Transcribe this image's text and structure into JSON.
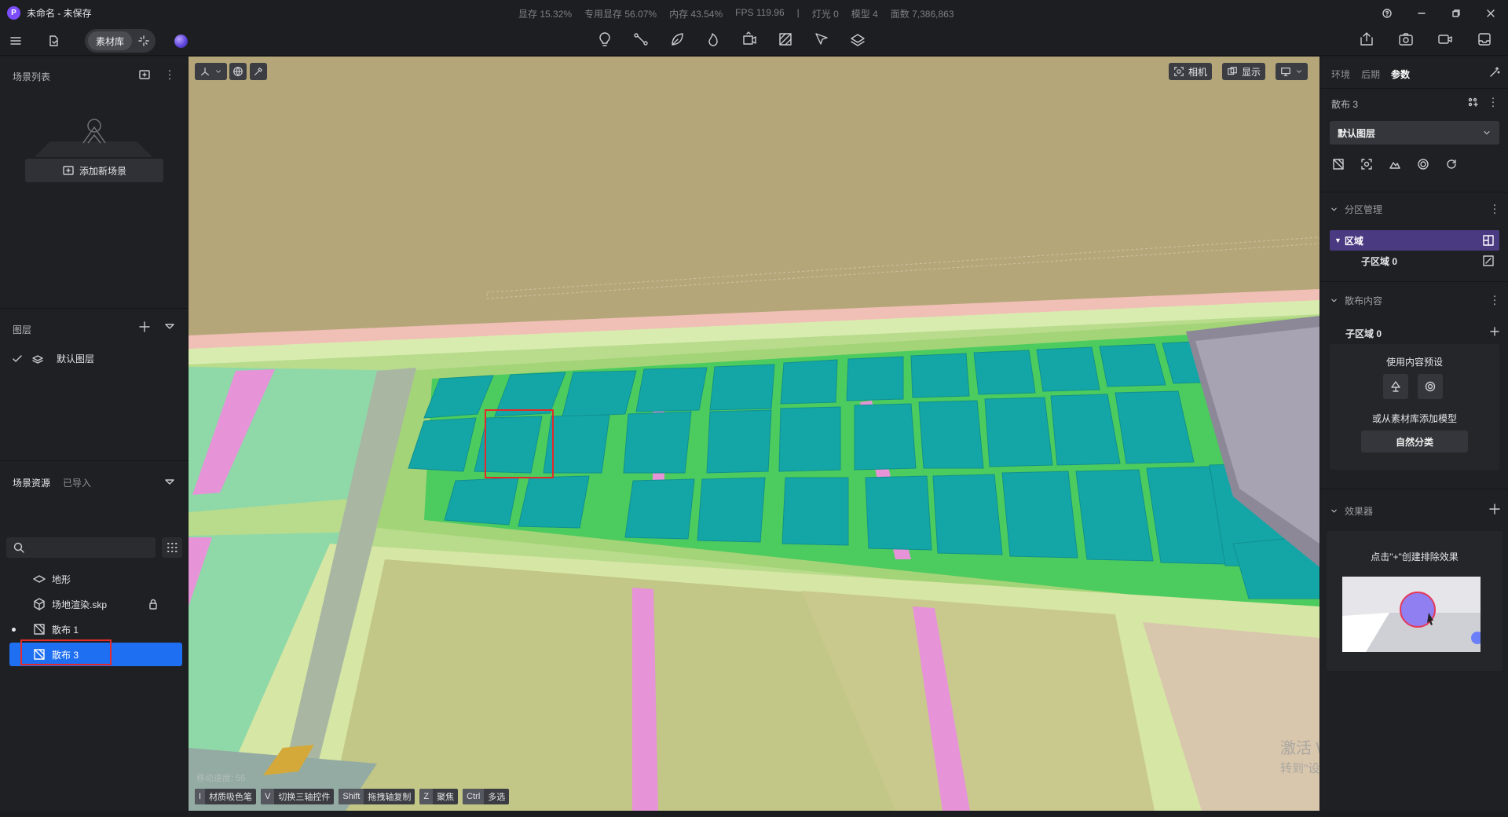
{
  "app": {
    "logo": "P",
    "title": "未命名 - 未保存"
  },
  "stats": {
    "vram": "显存 15.32%",
    "dedicated_vram": "专用显存 56.07%",
    "memory": "内存 43.54%",
    "fps": "FPS 119.96",
    "separator": "|",
    "lights": "灯光 0",
    "models": "模型 4",
    "faces": "面数 7,386,863"
  },
  "toolbar": {
    "material_library": "素材库",
    "center_icons": [
      "bulb-icon",
      "path-icon",
      "leaf-icon",
      "fire-icon",
      "camera-move-icon",
      "hatch-icon",
      "pen-select-icon",
      "layers-icon"
    ],
    "right_icons": [
      "share-icon",
      "screenshot-icon",
      "video-icon",
      "inbox-icon"
    ]
  },
  "left": {
    "scene_list_title": "场景列表",
    "add_scene": "添加新场景",
    "layers_title": "图层",
    "default_layer": "默认图层",
    "resources_tab": "场景资源",
    "imported_tab": "已导入",
    "tree": [
      {
        "label": "地形",
        "icon": "terrain-icon"
      },
      {
        "label": "场地渲染.skp",
        "icon": "cube-icon"
      },
      {
        "label": "散布 1",
        "icon": "scatter-icon"
      },
      {
        "label": "散布 3",
        "icon": "scatter-icon",
        "selected": true
      }
    ]
  },
  "viewport": {
    "camera": "相机",
    "display": "显示",
    "move_speed": "移动速度: 55",
    "shortcuts": [
      {
        "key": "I",
        "label": "材质吸色笔"
      },
      {
        "key": "V",
        "label": "切换三轴控件"
      },
      {
        "key": "Shift",
        "label": "拖拽轴复制"
      },
      {
        "key": "Z",
        "label": "聚焦"
      },
      {
        "key": "Ctrl",
        "label": "多选"
      }
    ],
    "watermark_line1": "激活 Windows",
    "watermark_line2": "转到\"设置\"以激活 Windows。"
  },
  "right": {
    "tabs": [
      "环境",
      "后期",
      "参数"
    ],
    "active_tab": "参数",
    "object_name": "散布 3",
    "layer_select": "默认图层",
    "zone_section": "分区管理",
    "region": "区域",
    "subregion": "子区域 0",
    "scatter_section": "散布内容",
    "scatter_subregion": "子区域 0",
    "use_preset": "使用内容预设",
    "or_add_model": "或从素材库添加模型",
    "nature_category": "自然分类",
    "effector_section": "效果器",
    "effector_hint": "点击\"+\"创建排除效果"
  },
  "colors": {
    "accent_blue": "#1e6ff2",
    "region_purple": "#4a3a82",
    "highlight_red": "#e52a2a",
    "panel_bg": "#1f2023"
  }
}
